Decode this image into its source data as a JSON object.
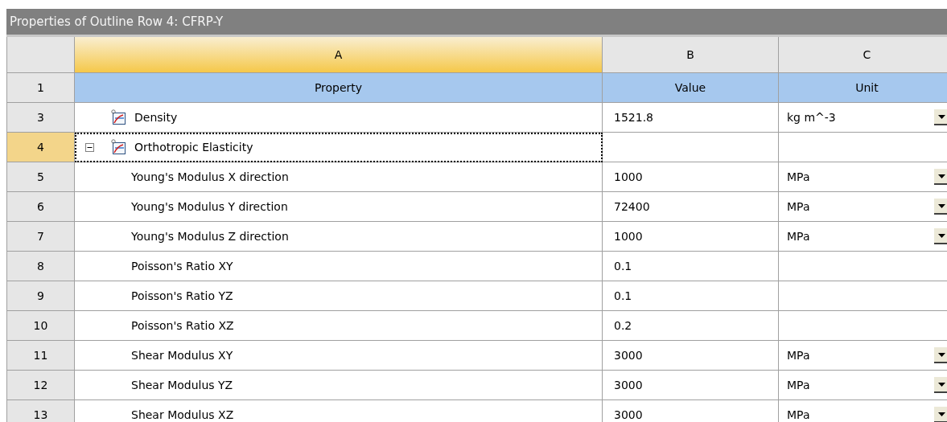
{
  "panel": {
    "title": "Properties of Outline Row 4: CFRP-Y"
  },
  "columns": [
    {
      "letter": "A",
      "heading": "Property",
      "selected": true
    },
    {
      "letter": "B",
      "heading": "Value",
      "selected": false
    },
    {
      "letter": "C",
      "heading": "Unit",
      "selected": false
    }
  ],
  "header_row_number": "1",
  "rows": [
    {
      "number": "3",
      "kind": "property",
      "property": "Density",
      "value": "1521.8",
      "unit": "kg m^-3",
      "unit_menu": true,
      "selected": false
    },
    {
      "number": "4",
      "kind": "group",
      "property": "Orthotropic Elasticity",
      "expanded": true,
      "selected": true,
      "children": [
        {
          "number": "5",
          "property": "Young's Modulus X direction",
          "value": "1000",
          "unit": "MPa",
          "unit_menu": true,
          "selected": false
        },
        {
          "number": "6",
          "property": "Young's Modulus Y direction",
          "value": "72400",
          "unit": "MPa",
          "unit_menu": true,
          "selected": false
        },
        {
          "number": "7",
          "property": "Young's Modulus Z direction",
          "value": "1000",
          "unit": "MPa",
          "unit_menu": true,
          "selected": false
        },
        {
          "number": "8",
          "property": "Poisson's Ratio XY",
          "value": "0.1",
          "unit_menu": false,
          "selected": false
        },
        {
          "number": "9",
          "property": "Poisson's Ratio YZ",
          "value": "0.1",
          "unit_menu": false,
          "selected": false
        },
        {
          "number": "10",
          "property": "Poisson's Ratio XZ",
          "value": "0.2",
          "unit_menu": false,
          "selected": false
        },
        {
          "number": "11",
          "property": "Shear Modulus XY",
          "value": "3000",
          "unit": "MPa",
          "unit_menu": true,
          "selected": false
        },
        {
          "number": "12",
          "property": "Shear Modulus YZ",
          "value": "3000",
          "unit": "MPa",
          "unit_menu": true,
          "selected": false
        },
        {
          "number": "13",
          "property": "Shear Modulus XZ",
          "value": "3000",
          "unit": "MPa",
          "unit_menu": true,
          "selected": false
        }
      ]
    }
  ]
}
